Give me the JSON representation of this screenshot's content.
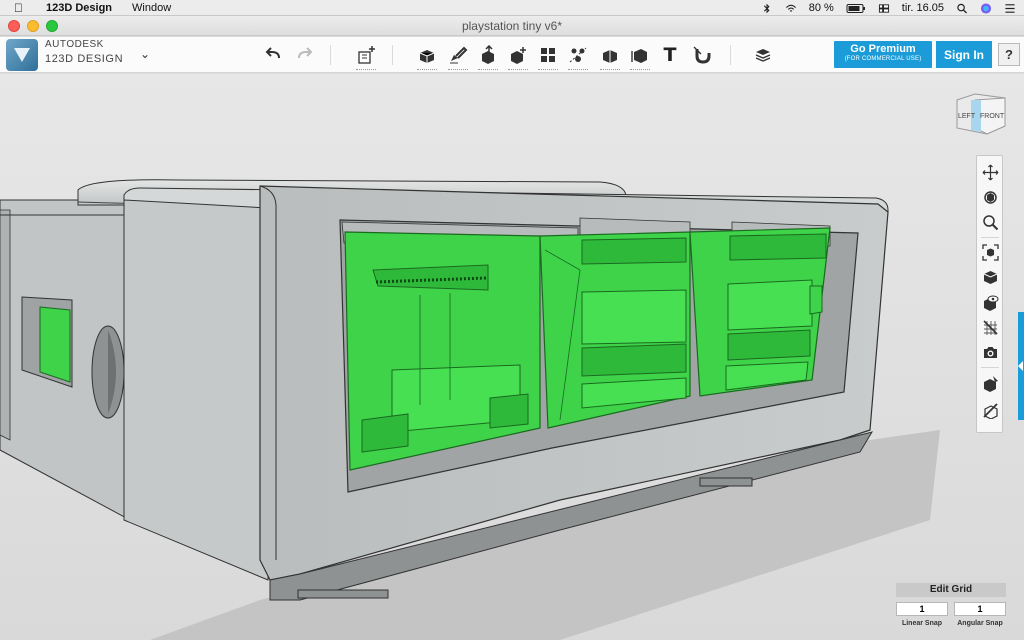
{
  "menubar": {
    "app_name": "123D Design",
    "menu_window": "Window",
    "battery": "80 %",
    "clock": "tir. 16.05"
  },
  "window": {
    "title": "playstation tiny v6*"
  },
  "brand": {
    "line1": "AUTODESK",
    "line2": "123D DESIGN"
  },
  "toolbar": {
    "premium_label": "Go Premium",
    "premium_sub": "(FOR COMMERCIAL USE)",
    "signin_label": "Sign In",
    "help_label": "?",
    "text_tool_glyph": "T"
  },
  "viewcube": {
    "left_label": "LEFT",
    "front_label": "FRONT"
  },
  "edit_grid": {
    "title": "Edit Grid",
    "linear_value": "1",
    "angular_value": "1",
    "linear_label": "Linear Snap",
    "angular_label": "Angular Snap"
  },
  "colors": {
    "accent": "#1b9bd8",
    "selection": "#3fd34a",
    "model": "#c9cccc"
  }
}
